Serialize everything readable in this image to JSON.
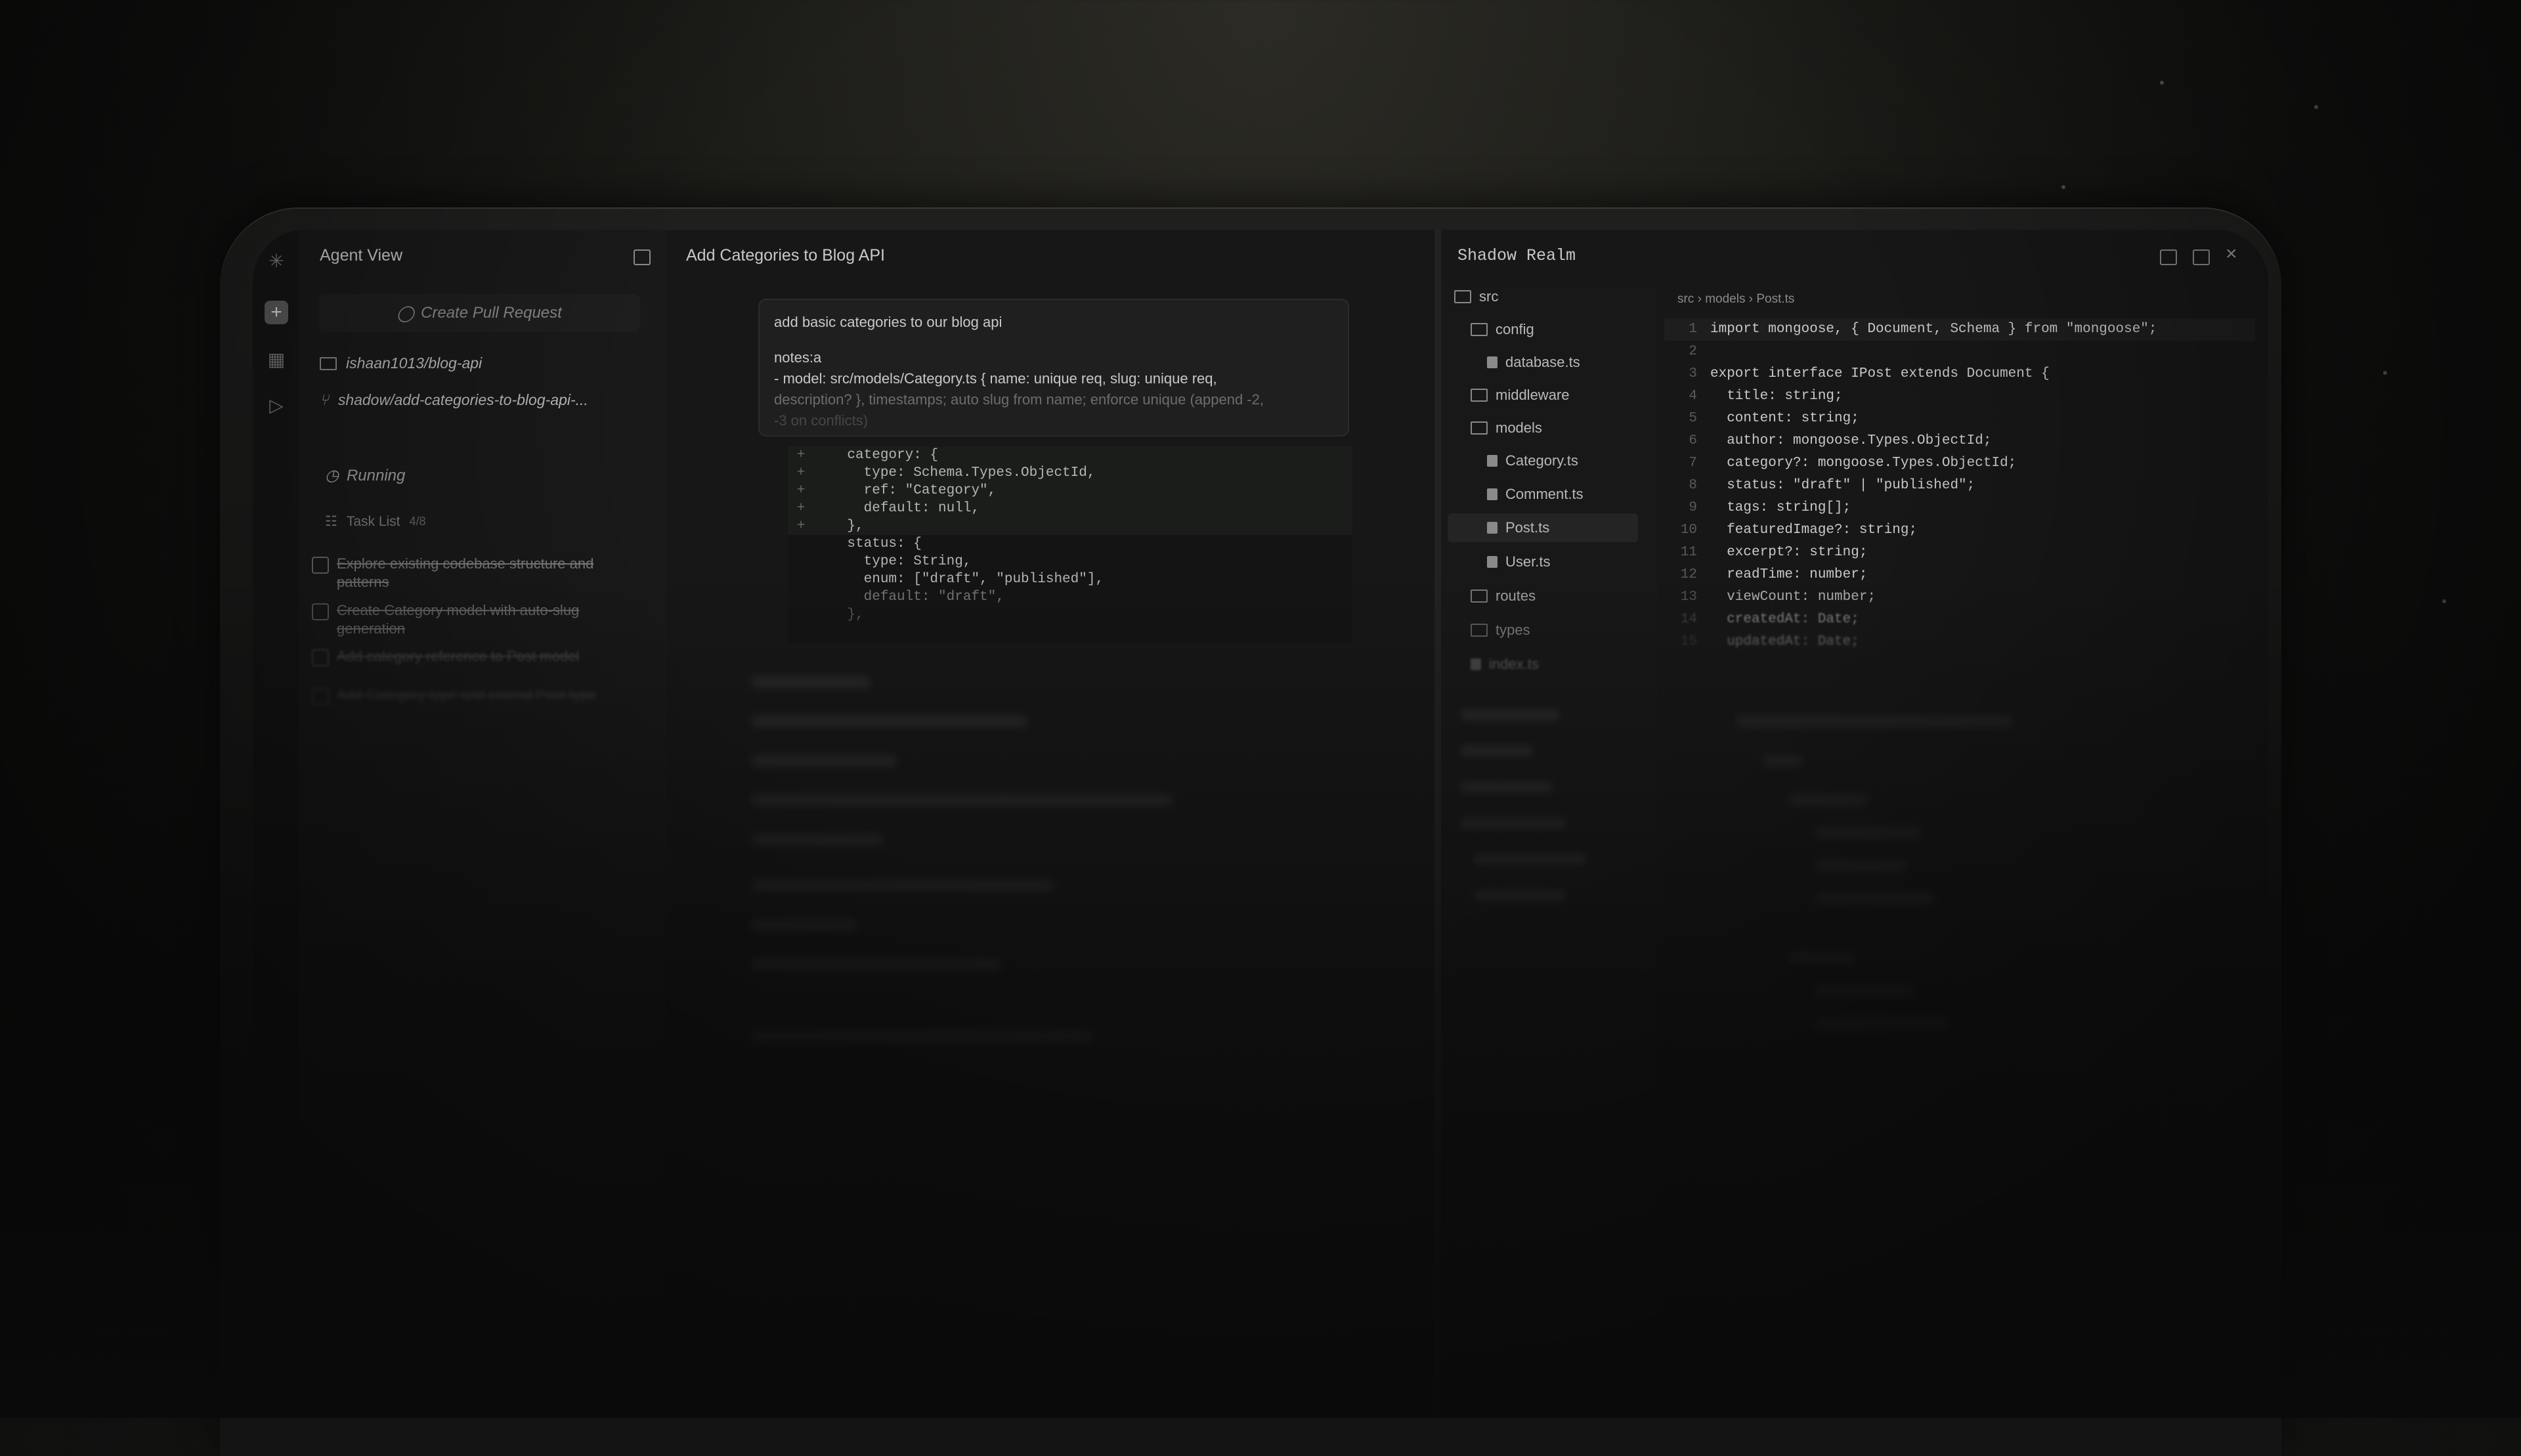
{
  "left_panel": {
    "title": "Agent View",
    "create_pr_label": "Create Pull Request",
    "repo": "ishaan1013/blog-api",
    "branch": "shadow/add-categories-to-blog-api-...",
    "status": "Running",
    "task_list_label": "Task List",
    "task_count": "4/8",
    "tasks": [
      "Explore existing codebase structure and patterns",
      "Create Category model with auto-slug generation",
      "Add category reference to Post model",
      "Add Category type and extend Post type"
    ]
  },
  "middle_panel": {
    "title": "Add Categories to Blog API",
    "message_line1": "add basic categories to our blog api",
    "message_notes": "notes:a",
    "message_model": "- model: src/models/Category.ts { name: unique req, slug: unique req,",
    "message_model2": "description? }, timestamps; auto slug from name; enforce unique (append -2,",
    "message_model3": "-3 on conflicts)",
    "diff": [
      "    category: {",
      "      type: Schema.Types.ObjectId,",
      "      ref: \"Category\",",
      "      default: null,",
      "    },",
      "    status: {",
      "      type: String,",
      "      enum: [\"draft\", \"published\"],",
      "      default: \"draft\",",
      "    },"
    ]
  },
  "right_panel": {
    "title": "Shadow Realm",
    "tree": {
      "src": "src",
      "config": "config",
      "database": "database.ts",
      "middleware": "middleware",
      "models": "models",
      "category": "Category.ts",
      "comment": "Comment.ts",
      "post": "Post.ts",
      "user": "User.ts",
      "routes": "routes",
      "types": "types",
      "index": "index.ts"
    },
    "breadcrumb": "src › models › Post.ts",
    "code": [
      {
        "n": "1",
        "t": "import mongoose, { Document, Schema } from \"mongoose\";"
      },
      {
        "n": "2",
        "t": ""
      },
      {
        "n": "3",
        "t": "export interface IPost extends Document {"
      },
      {
        "n": "4",
        "t": "  title: string;"
      },
      {
        "n": "5",
        "t": "  content: string;"
      },
      {
        "n": "6",
        "t": "  author: mongoose.Types.ObjectId;"
      },
      {
        "n": "7",
        "t": "  category?: mongoose.Types.ObjectId;"
      },
      {
        "n": "8",
        "t": "  status: \"draft\" | \"published\";"
      },
      {
        "n": "9",
        "t": "  tags: string[];"
      },
      {
        "n": "10",
        "t": "  featuredImage?: string;"
      },
      {
        "n": "11",
        "t": "  excerpt?: string;"
      },
      {
        "n": "12",
        "t": "  readTime: number;"
      },
      {
        "n": "13",
        "t": "  viewCount: number;"
      },
      {
        "n": "14",
        "t": "  createdAt: Date;"
      },
      {
        "n": "15",
        "t": "  updatedAt: Date;"
      }
    ]
  },
  "colors": {
    "background": "#111110",
    "panel": "#171717",
    "text": "#c9c9c9"
  }
}
